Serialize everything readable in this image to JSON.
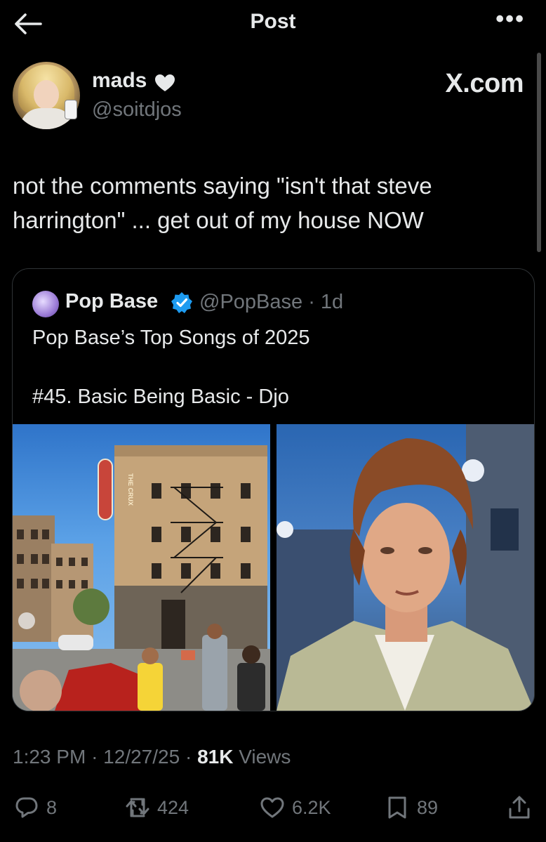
{
  "header": {
    "title": "Post"
  },
  "author": {
    "name": "mads",
    "handle": "@soitdjos"
  },
  "watermark": "X.com",
  "post": {
    "text_line1": "not the comments saying \"isn't that steve",
    "text_line2": "harrington\" ... get out of my house NOW"
  },
  "quote": {
    "name": "Pop Base",
    "handle_time": "@PopBase · 1d",
    "line1": "Pop Base’s Top Songs of 2025",
    "line2": "#45. Basic Being Basic - Djo",
    "sign_text": "THE CRUX"
  },
  "meta": {
    "time": "1:23 PM",
    "date": "12/27/25",
    "views_count": "81K",
    "views_label": "Views"
  },
  "actions": {
    "replies": "8",
    "reposts": "424",
    "likes": "6.2K",
    "bookmarks": "89"
  },
  "colors": {
    "background": "#000000",
    "text": "#e7e9ea",
    "secondary": "#71767b",
    "verified": "#1d9bf0"
  },
  "icons": [
    "back-arrow-icon",
    "more-icon",
    "heart-emoji-icon",
    "verified-badge-icon",
    "reply-icon",
    "repost-icon",
    "like-icon",
    "bookmark-icon",
    "share-icon"
  ]
}
